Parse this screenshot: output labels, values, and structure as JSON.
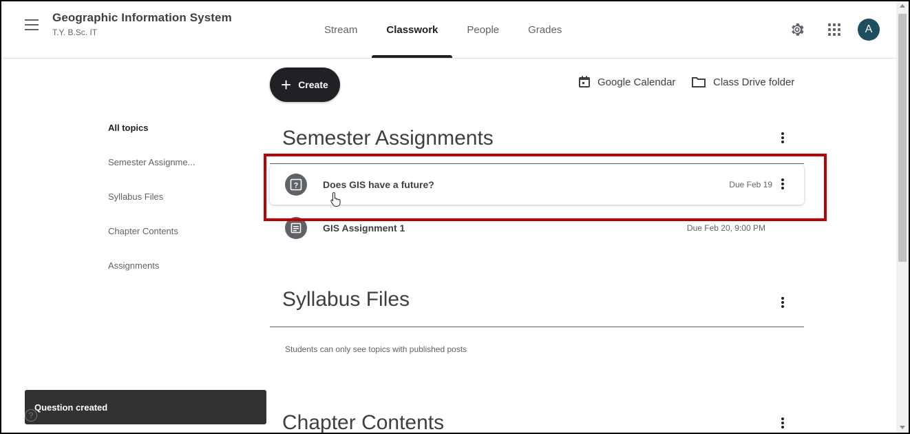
{
  "header": {
    "class_name": "Geographic Information System",
    "class_section": "T.Y. B.Sc. IT",
    "tabs": [
      {
        "label": "Stream",
        "active": false
      },
      {
        "label": "Classwork",
        "active": true
      },
      {
        "label": "People",
        "active": false
      },
      {
        "label": "Grades",
        "active": false
      }
    ],
    "avatar_letter": "A"
  },
  "toolbar": {
    "create_label": "Create",
    "calendar_label": "Google Calendar",
    "drive_label": "Class Drive folder"
  },
  "sidebar": {
    "items": [
      {
        "label": "All topics"
      },
      {
        "label": "Semester Assignme..."
      },
      {
        "label": "Syllabus Files"
      },
      {
        "label": "Chapter Contents"
      },
      {
        "label": "Assignments"
      }
    ]
  },
  "topics": [
    {
      "title": "Semester Assignments",
      "items": [
        {
          "title": "Does GIS have a future?",
          "due": "Due Feb 19",
          "icon": "question-icon"
        },
        {
          "title": "GIS Assignment 1",
          "due": "Due Feb 20, 9:00 PM",
          "icon": "assignment-icon"
        }
      ]
    },
    {
      "title": "Syllabus Files",
      "note": "Students can only see topics with published posts"
    },
    {
      "title": "Chapter Contents"
    }
  ],
  "snackbar": {
    "message": "Question created"
  },
  "colors": {
    "highlight": "#c00000",
    "dark": "#202124",
    "avatar": "#1f4e5f"
  }
}
